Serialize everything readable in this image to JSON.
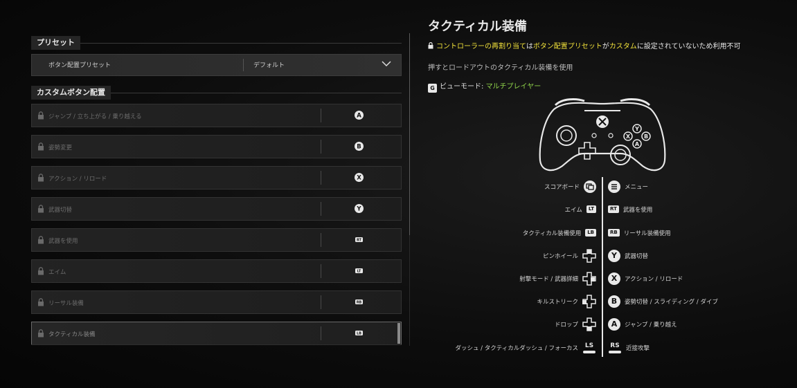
{
  "preset_section": {
    "title": "プリセット"
  },
  "preset": {
    "name": "ボタン配置プリセット",
    "value": "デフォルト"
  },
  "custom_section": {
    "title": "カスタムボタン配置"
  },
  "bindings": [
    {
      "label": "ジャンプ / 立ち上がる / 乗り越える",
      "button": "A",
      "btn_type": "circle"
    },
    {
      "label": "姿勢変更",
      "button": "B",
      "btn_type": "circle"
    },
    {
      "label": "アクション / リロード",
      "button": "X",
      "btn_type": "circle"
    },
    {
      "label": "武器切替",
      "button": "Y",
      "btn_type": "circle"
    },
    {
      "label": "武器を使用",
      "button": "RT",
      "btn_type": "trigger"
    },
    {
      "label": "エイム",
      "button": "LT",
      "btn_type": "trigger"
    },
    {
      "label": "リーサル装備",
      "button": "RB",
      "btn_type": "bumper"
    },
    {
      "label": "タクティカル装備",
      "button": "LB",
      "btn_type": "bumper",
      "selected": true
    }
  ],
  "detail": {
    "title": "タクティカル装備",
    "warning": {
      "p1": "コントローラーの再割り当て",
      "p2": "は",
      "p3": "ボタン配置プリセット",
      "p4": "が",
      "p5": "カスタム",
      "p6": "に設定されていないため利用不可"
    },
    "description": "押すとロードアウトのタクティカル装備を使用",
    "view_key": "G",
    "view_label": "ビューモード: ",
    "view_value": "マルチプレイヤー"
  },
  "mapping_left": [
    {
      "label": "スコアボード",
      "icon": "view"
    },
    {
      "label": "エイム",
      "icon": "LT"
    },
    {
      "label": "タクティカル装備使用",
      "icon": "LB"
    },
    {
      "label": "ピンホイール",
      "icon": "dpad-up"
    },
    {
      "label": "射撃モード / 武器詳細",
      "icon": "dpad-right"
    },
    {
      "label": "キルストリーク",
      "icon": "dpad-left"
    },
    {
      "label": "ドロップ",
      "icon": "dpad-down"
    },
    {
      "label": "ダッシュ / タクティカルダッシュ / フォーカス",
      "icon": "LS"
    }
  ],
  "mapping_right": [
    {
      "label": "メニュー",
      "icon": "menu"
    },
    {
      "label": "武器を使用",
      "icon": "RT"
    },
    {
      "label": "リーサル装備使用",
      "icon": "RB"
    },
    {
      "label": "武器切替",
      "icon": "Y"
    },
    {
      "label": "アクション / リロード",
      "icon": "X"
    },
    {
      "label": "姿勢切替 / スライディング / ダイブ",
      "icon": "B"
    },
    {
      "label": "ジャンプ / 乗り越え",
      "icon": "A"
    },
    {
      "label": "近接攻撃",
      "icon": "RS"
    }
  ],
  "colors": {
    "highlight": "#f2e23a",
    "green": "#8fd34a"
  }
}
